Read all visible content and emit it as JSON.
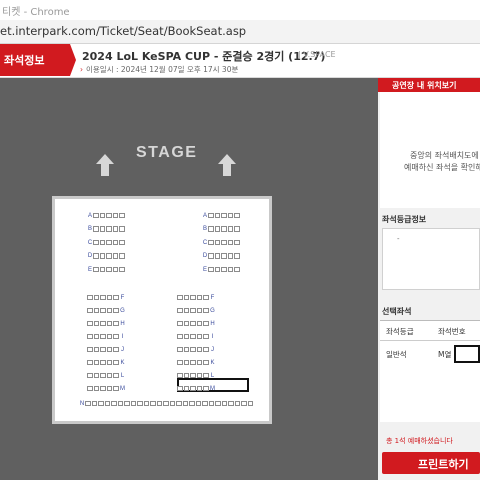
{
  "window": {
    "title": "티켓 - Chrome"
  },
  "address_bar": {
    "url": "et.interpark.com/Ticket/Seat/BookSeat.asp"
  },
  "header": {
    "tab_label": "좌석정보",
    "event_title": "2024 LoL KeSPA CUP - 준결승 2경기 (12.7)",
    "venue": "| V.SPACE",
    "date_text": "이용일시 : 2024년 12월 07일 오후 17시 30분"
  },
  "stage": {
    "label": "STAGE"
  },
  "seat_rows": [
    {
      "label": "A",
      "left_seats": 5,
      "right_seats": 5,
      "side": "top"
    },
    {
      "label": "B",
      "left_seats": 5,
      "right_seats": 5,
      "side": "top"
    },
    {
      "label": "C",
      "left_seats": 5,
      "right_seats": 5,
      "side": "top"
    },
    {
      "label": "D",
      "left_seats": 5,
      "right_seats": 5,
      "side": "top"
    },
    {
      "label": "E",
      "left_seats": 5,
      "right_seats": 5,
      "side": "top"
    },
    {
      "label": "F",
      "left_seats": 5,
      "right_seats": 5,
      "side": "bottom"
    },
    {
      "label": "G",
      "left_seats": 5,
      "right_seats": 5,
      "side": "bottom"
    },
    {
      "label": "H",
      "left_seats": 5,
      "right_seats": 5,
      "side": "bottom"
    },
    {
      "label": "I",
      "left_seats": 5,
      "right_seats": 5,
      "side": "bottom"
    },
    {
      "label": "J",
      "left_seats": 5,
      "right_seats": 5,
      "side": "bottom"
    },
    {
      "label": "K",
      "left_seats": 5,
      "right_seats": 5,
      "side": "bottom"
    },
    {
      "label": "L",
      "left_seats": 5,
      "right_seats": 5,
      "side": "bottom"
    },
    {
      "label": "M",
      "left_seats": 5,
      "right_seats": 5,
      "side": "bottom"
    },
    {
      "label": "N",
      "seats": 26,
      "side": "full"
    }
  ],
  "right_panel": {
    "position_header": "공연장 내 위치보기",
    "position_msg_1": "중앙의 좌석배치도에",
    "position_msg_2": "예매하신 좌석을 확인해",
    "grade_header": "좌석등급정보",
    "grade_dash": "-",
    "selected_header": "선택좌석",
    "table_col_grade": "좌석등급",
    "table_col_seat": "좌석번호",
    "row_grade": "일반석",
    "row_seat": "M열",
    "count_text": "총 1석 예매하셨습니다",
    "print_button": "프린트하기"
  },
  "colors": {
    "brand_red": "#d11a1f",
    "stage_bg": "#606060",
    "row_label_blue": "#3a4b9c"
  }
}
